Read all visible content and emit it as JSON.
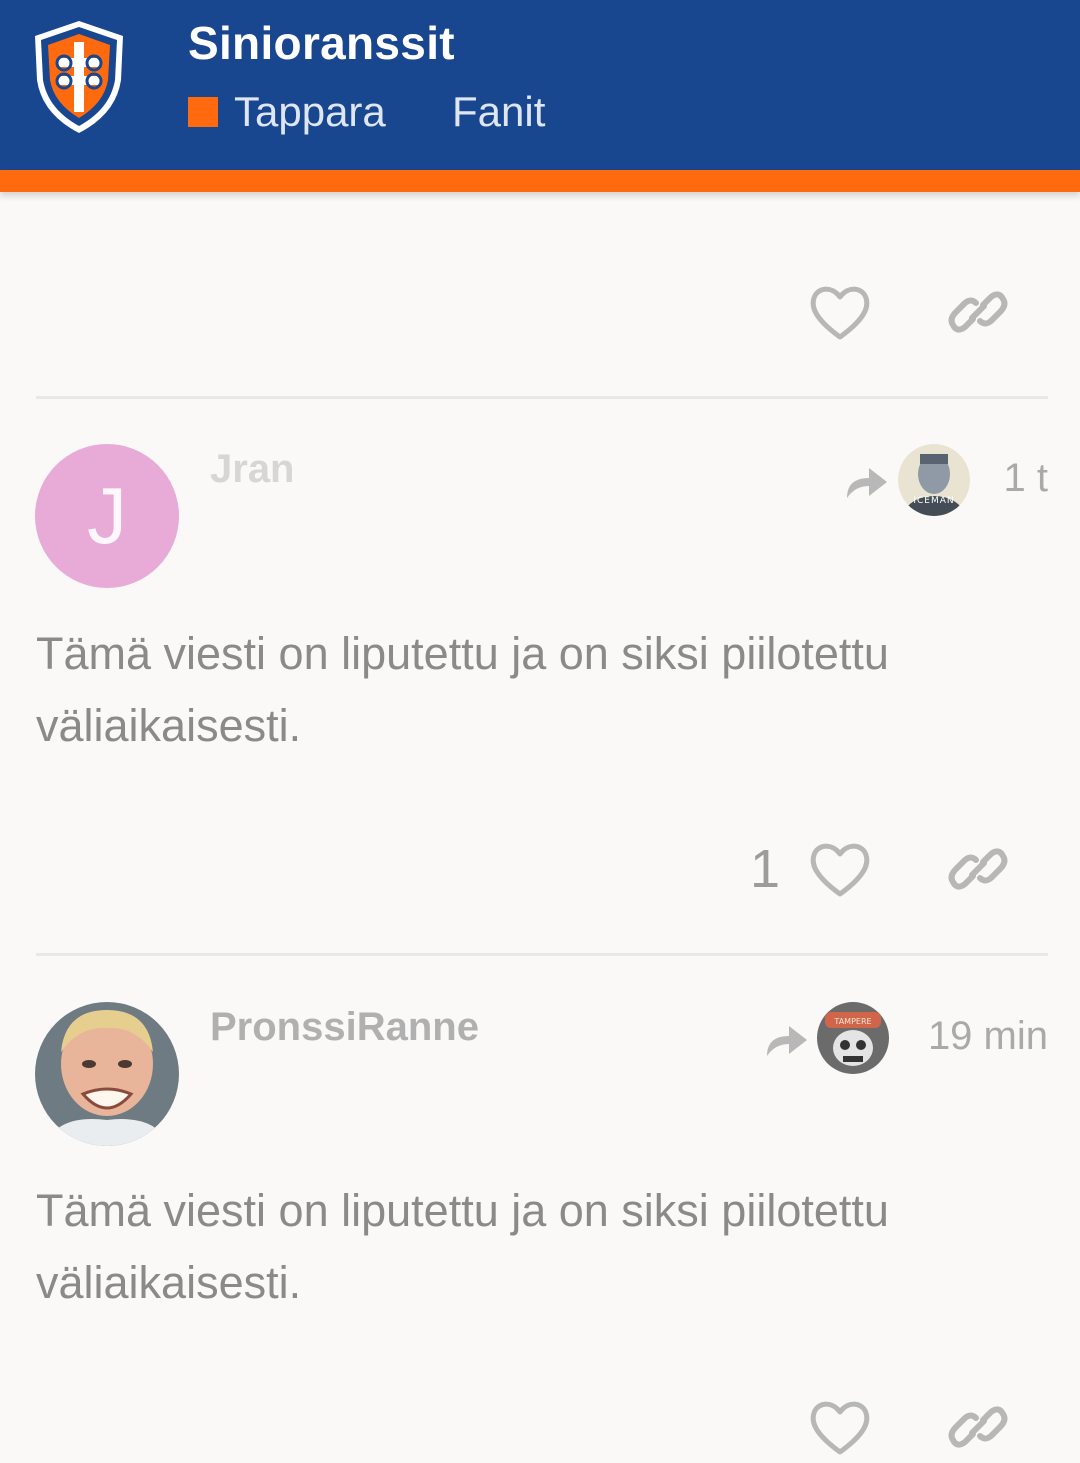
{
  "header": {
    "site_title": "Sinioranssit",
    "category_label": "Tappara",
    "tag_label": "Fanit",
    "logo_icon": "tappara-logo-icon",
    "colors": {
      "header_bg": "#18468f",
      "accent": "#ff6a0e"
    }
  },
  "posts": [
    {
      "username": "Jran",
      "avatar_letter": "J",
      "avatar_color": "#e8aad6",
      "reply_to_avatar_label": "ICEMAN",
      "time": "1 t",
      "body": "Tämä viesti on liputettu ja on siksi piilotettu väliaikaisesti.",
      "like_count": "1"
    },
    {
      "username": "PronssiRanne",
      "reply_to_avatar_label": "TAMPERE",
      "time": "19 min",
      "body": "Tämä viesti on liputettu ja on siksi piilotettu väliaikaisesti."
    }
  ],
  "icons": {
    "like": "heart-icon",
    "share": "link-icon",
    "reply": "reply-arrow-icon"
  }
}
